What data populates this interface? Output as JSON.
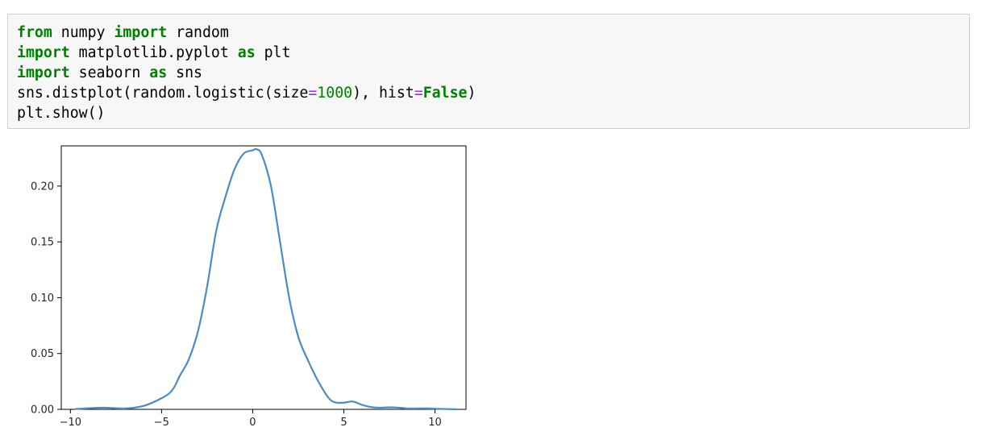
{
  "code_cell": {
    "lines": [
      [
        {
          "t": "kw",
          "s": "from"
        },
        {
          "t": "n",
          "s": " numpy "
        },
        {
          "t": "kw",
          "s": "import"
        },
        {
          "t": "n",
          "s": " random"
        }
      ],
      [
        {
          "t": "kw",
          "s": "import"
        },
        {
          "t": "n",
          "s": " matplotlib.pyplot "
        },
        {
          "t": "kw",
          "s": "as"
        },
        {
          "t": "n",
          "s": " plt"
        }
      ],
      [
        {
          "t": "kw",
          "s": "import"
        },
        {
          "t": "n",
          "s": " seaborn "
        },
        {
          "t": "kw",
          "s": "as"
        },
        {
          "t": "n",
          "s": " sns"
        }
      ],
      [
        {
          "t": "n",
          "s": "sns.distplot(random.logistic(size"
        },
        {
          "t": "op",
          "s": "="
        },
        {
          "t": "num",
          "s": "1000"
        },
        {
          "t": "n",
          "s": "), hist"
        },
        {
          "t": "op",
          "s": "="
        },
        {
          "t": "kw",
          "s": "False"
        },
        {
          "t": "n",
          "s": ")"
        }
      ],
      [
        {
          "t": "n",
          "s": "plt.show()"
        }
      ]
    ],
    "colors": {
      "keyword": "#008000",
      "operator": "#aa22ff",
      "number": "#008000",
      "background": "#f7f7f7",
      "border": "#cfcfcf"
    }
  },
  "chart_data": {
    "type": "line",
    "title": "",
    "xlabel": "",
    "ylabel": "",
    "xlim": [
      -10.5,
      11.7
    ],
    "ylim": [
      0,
      0.236
    ],
    "xticks": [
      -10,
      -5,
      0,
      5,
      10
    ],
    "xtick_labels": [
      "−10",
      "−5",
      "0",
      "5",
      "10"
    ],
    "yticks": [
      0.0,
      0.05,
      0.1,
      0.15,
      0.2
    ],
    "ytick_labels": [
      "0.00",
      "0.05",
      "0.10",
      "0.15",
      "0.20"
    ],
    "grid": false,
    "series": [
      {
        "color": "#4c8cbf",
        "x": [
          -9.7,
          -9.0,
          -8.2,
          -7.5,
          -7.0,
          -6.5,
          -6.0,
          -5.5,
          -5.0,
          -4.6,
          -4.3,
          -4.0,
          -3.5,
          -3.0,
          -2.5,
          -2.0,
          -1.5,
          -1.0,
          -0.5,
          0.0,
          0.2,
          0.5,
          1.0,
          1.5,
          2.0,
          2.5,
          3.0,
          3.5,
          4.0,
          4.3,
          4.6,
          5.0,
          5.5,
          6.0,
          6.5,
          7.0,
          7.5,
          8.0,
          8.5,
          9.0,
          9.5,
          10.0,
          10.5,
          11.2
        ],
        "y": [
          0.0003,
          0.001,
          0.0015,
          0.001,
          0.0008,
          0.0015,
          0.003,
          0.006,
          0.01,
          0.014,
          0.02,
          0.03,
          0.045,
          0.07,
          0.11,
          0.16,
          0.19,
          0.215,
          0.229,
          0.232,
          0.233,
          0.228,
          0.2,
          0.15,
          0.1,
          0.065,
          0.045,
          0.028,
          0.014,
          0.008,
          0.006,
          0.006,
          0.007,
          0.004,
          0.002,
          0.0015,
          0.0018,
          0.0015,
          0.0008,
          0.0008,
          0.0009,
          0.0006,
          0.0003,
          0.0001
        ]
      }
    ]
  }
}
